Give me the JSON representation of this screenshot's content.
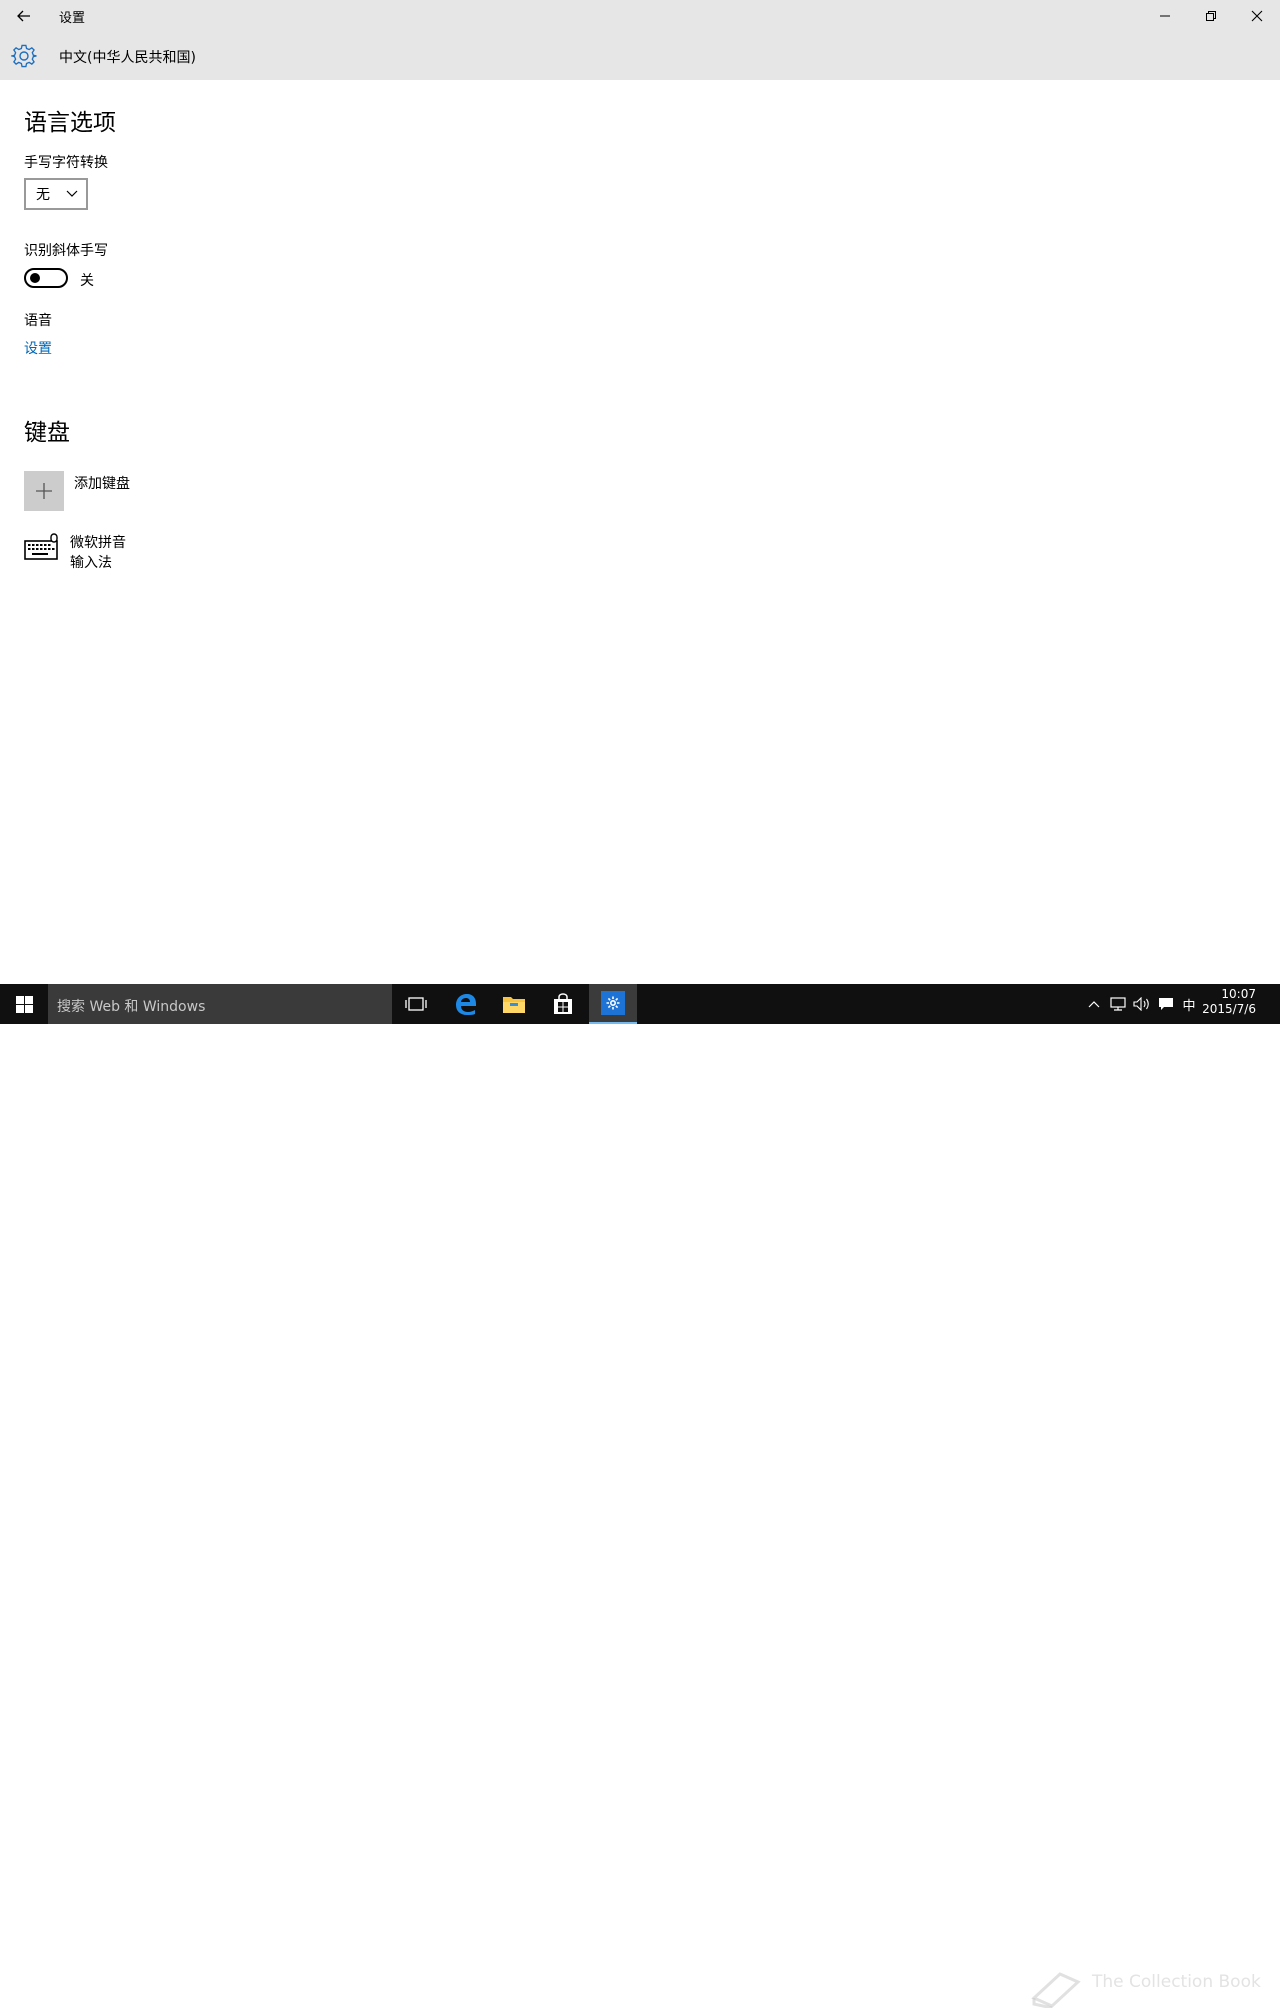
{
  "window": {
    "title": "设置",
    "page_header": "中文(中华人民共和国)"
  },
  "language_options": {
    "heading": "语言选项",
    "handwriting_conversion": {
      "label": "手写字符转换",
      "selected": "无"
    },
    "italic_handwriting": {
      "label": "识别斜体手写",
      "state": "关",
      "on": false
    },
    "speech": {
      "label": "语音",
      "link": "设置"
    }
  },
  "keyboard": {
    "heading": "键盘",
    "add_label": "添加键盘",
    "installed": {
      "name_line1": "微软拼音",
      "name_line2": "输入法"
    }
  },
  "taskbar": {
    "search_placeholder": "搜索 Web 和 Windows",
    "ime_indicator": "中",
    "time": "10:07",
    "date": "2015/7/6",
    "watermark": "The Collection Book"
  },
  "colors": {
    "accent": "#0067b8",
    "titlebar": "#e6e6e6",
    "taskbar": "#101010"
  },
  "icons": [
    "back-icon",
    "minimize-icon",
    "restore-icon",
    "close-icon",
    "gear-icon",
    "chevron-down-icon",
    "plus-icon",
    "keyboard-icon",
    "windows-logo-icon",
    "task-view-icon",
    "edge-icon",
    "file-explorer-icon",
    "store-icon",
    "settings-icon",
    "up-chevron-icon",
    "network-icon",
    "volume-icon",
    "action-center-icon",
    "book-icon"
  ]
}
